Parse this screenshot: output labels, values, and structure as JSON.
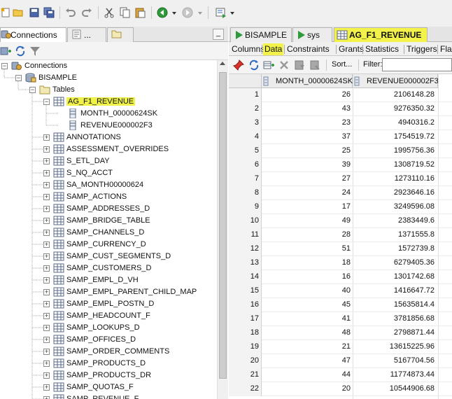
{
  "toolbar": {
    "icons": [
      "new-icon",
      "open-folder-icon",
      "save-icon",
      "save-all-icon",
      "undo-icon",
      "redo-icon",
      "cut-icon",
      "copy-icon",
      "paste-icon",
      "back-icon",
      "forward-icon",
      "sql-worksheet-icon"
    ]
  },
  "left_panel": {
    "tabs": [
      {
        "label": "Connections",
        "icon": "connections-icon",
        "active": true
      },
      {
        "label": "...",
        "icon": "reports-icon",
        "active": false
      },
      {
        "label": "",
        "icon": "folder-icon",
        "active": false
      }
    ],
    "minimize_label": "_",
    "tree": {
      "root": "Connections",
      "connection": "BISAMPLE",
      "folder": "Tables",
      "selected_table": "AG_F1_REVENUE",
      "columns": [
        "MONTH_00000624SK",
        "REVENUE000002F3"
      ],
      "tables": [
        "ANNOTATIONS",
        "ASSESSMENT_OVERRIDES",
        "S_ETL_DAY",
        "S_NQ_ACCT",
        "SA_MONTH00000624",
        "SAMP_ACTIONS",
        "SAMP_ADDRESSES_D",
        "SAMP_BRIDGE_TABLE",
        "SAMP_CHANNELS_D",
        "SAMP_CURRENCY_D",
        "SAMP_CUST_SEGMENTS_D",
        "SAMP_CUSTOMERS_D",
        "SAMP_EMPL_D_VH",
        "SAMP_EMPL_PARENT_CHILD_MAP",
        "SAMP_EMPL_POSTN_D",
        "SAMP_HEADCOUNT_F",
        "SAMP_LOOKUPS_D",
        "SAMP_OFFICES_D",
        "SAMP_ORDER_COMMENTS",
        "SAMP_PRODUCTS_D",
        "SAMP_PRODUCTS_DR",
        "SAMP_QUOTAS_F",
        "SAMP_REVENUE_F"
      ]
    }
  },
  "right_panel": {
    "doc_tabs": [
      {
        "label": "BISAMPLE",
        "active": false
      },
      {
        "label": "sys",
        "active": false
      },
      {
        "label": "AG_F1_REVENUE",
        "active": true
      }
    ],
    "sub_tabs": [
      "Columns",
      "Data",
      "Constraints",
      "Grants",
      "Statistics",
      "Triggers",
      "Flashba"
    ],
    "active_sub_tab": "Data",
    "sort_label": "Sort...",
    "filter_label": "Filter:",
    "filter_value": "",
    "grid": {
      "columns": [
        "MONTH_00000624SK",
        "REVENUE000002F3"
      ],
      "rows": [
        [
          "1",
          "26",
          "2106148.28"
        ],
        [
          "2",
          "43",
          "9276350.32"
        ],
        [
          "3",
          "23",
          "4940316.2"
        ],
        [
          "4",
          "37",
          "1754519.72"
        ],
        [
          "5",
          "25",
          "1995756.36"
        ],
        [
          "6",
          "39",
          "1308719.52"
        ],
        [
          "7",
          "27",
          "1273110.16"
        ],
        [
          "8",
          "24",
          "2923646.16"
        ],
        [
          "9",
          "17",
          "3249596.08"
        ],
        [
          "10",
          "49",
          "2383449.6"
        ],
        [
          "11",
          "28",
          "1371555.8"
        ],
        [
          "12",
          "51",
          "1572739.8"
        ],
        [
          "13",
          "18",
          "6279405.36"
        ],
        [
          "14",
          "16",
          "1301742.68"
        ],
        [
          "15",
          "40",
          "1416647.72"
        ],
        [
          "16",
          "45",
          "15635814.4"
        ],
        [
          "17",
          "41",
          "3781856.68"
        ],
        [
          "18",
          "48",
          "2798871.44"
        ],
        [
          "19",
          "21",
          "13615225.96"
        ],
        [
          "20",
          "47",
          "5167704.56"
        ],
        [
          "21",
          "44",
          "11774873.44"
        ],
        [
          "22",
          "20",
          "10544906.68"
        ]
      ]
    }
  }
}
